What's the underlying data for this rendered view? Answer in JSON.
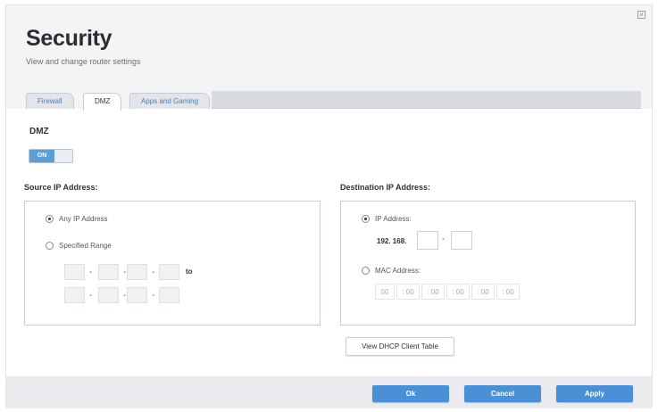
{
  "header": {
    "title": "Security",
    "subtitle": "View and change router settings"
  },
  "icons": {
    "close": "close-icon"
  },
  "tabs": [
    {
      "label": "Firewall",
      "active": false
    },
    {
      "label": "DMZ",
      "active": true
    },
    {
      "label": "Apps and Gaming",
      "active": false
    }
  ],
  "dmz": {
    "label": "DMZ",
    "toggle_label": "ON",
    "state": "on"
  },
  "source": {
    "heading": "Source IP Address:",
    "any_label": "Any IP Address",
    "specified_label": "Specified Range",
    "range_to": "to",
    "selected": "any"
  },
  "destination": {
    "heading": "Destination IP Address:",
    "ip_label": "IP Address:",
    "ip_prefix": "192. 168.",
    "mac_label": "MAC Address:",
    "mac_values": [
      "00",
      ": 00",
      ": 00",
      ": 00",
      ": 00",
      ": 00"
    ],
    "selected": "ip",
    "dhcp_button": "View DHCP Client Table"
  },
  "footer": {
    "ok_label": "Ok",
    "cancel_label": "Cancel",
    "apply_label": "Apply"
  },
  "colors": {
    "accent": "#4a90d6",
    "toggle_on": "#5b9fd6",
    "header_bg": "#f3f4f5"
  }
}
